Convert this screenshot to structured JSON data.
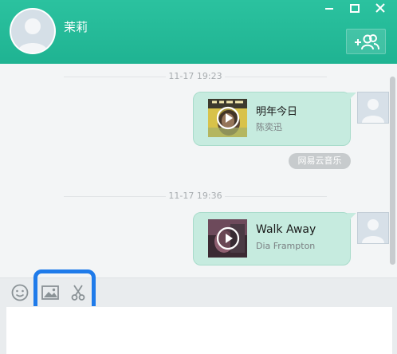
{
  "contact": {
    "name": "茉莉"
  },
  "messages": [
    {
      "time": "11-17 19:23",
      "title": "明年今日",
      "artist": "陈奕迅",
      "cover": "album-cover-eason-icon"
    },
    {
      "time": "11-17 19:36",
      "title": "Walk Away",
      "artist": "Dia Frampton",
      "cover": "album-cover-dia-icon"
    }
  ],
  "source_tag": "网易云音乐",
  "toolbar": {
    "icons": [
      "emoji-icon",
      "image-icon",
      "scissors-icon"
    ]
  },
  "input": {
    "value": ""
  },
  "colors": {
    "header": "#1fb392",
    "bubble": "#c6ebdf",
    "highlight": "#1f7bea"
  }
}
